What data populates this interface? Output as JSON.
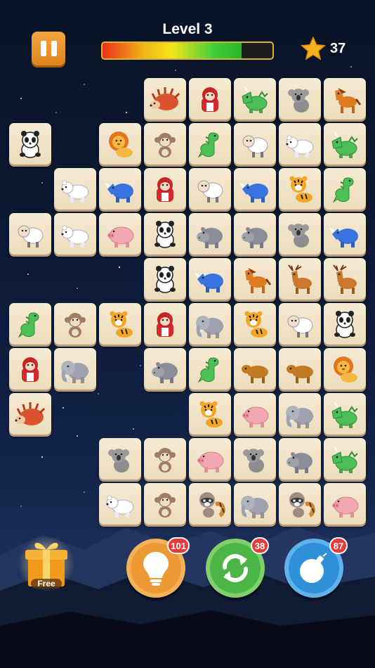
{
  "header": {
    "level_label": "Level 3",
    "progress_fraction": 0.82,
    "star_count": "37"
  },
  "colors": {
    "tile_face": "#f3e6cc",
    "pause_button": "#eb9530",
    "hint_button": "#f0a23a",
    "shuffle_button": "#4bb548",
    "bomb_button": "#2f8fd8",
    "badge": "#e83a3a"
  },
  "board": {
    "tiles": [
      {
        "col": 3,
        "row": 0,
        "animal": "hedgehog"
      },
      {
        "col": 4,
        "row": 0,
        "animal": "gorilla"
      },
      {
        "col": 5,
        "row": 0,
        "animal": "triceratops"
      },
      {
        "col": 6,
        "row": 0,
        "animal": "koala"
      },
      {
        "col": 7,
        "row": 0,
        "animal": "horse"
      },
      {
        "col": 0,
        "row": 1,
        "animal": "panda"
      },
      {
        "col": 2,
        "row": 1,
        "animal": "lion"
      },
      {
        "col": 3,
        "row": 1,
        "animal": "monkey"
      },
      {
        "col": 4,
        "row": 1,
        "animal": "dinosaur"
      },
      {
        "col": 5,
        "row": 1,
        "animal": "sheep"
      },
      {
        "col": 6,
        "row": 1,
        "animal": "polar-bear"
      },
      {
        "col": 7,
        "row": 1,
        "animal": "triceratops"
      },
      {
        "col": 1,
        "row": 2,
        "animal": "polar-bear"
      },
      {
        "col": 2,
        "row": 2,
        "animal": "rhino"
      },
      {
        "col": 3,
        "row": 2,
        "animal": "gorilla"
      },
      {
        "col": 4,
        "row": 2,
        "animal": "sheep"
      },
      {
        "col": 5,
        "row": 2,
        "animal": "rhino"
      },
      {
        "col": 6,
        "row": 2,
        "animal": "tiger"
      },
      {
        "col": 7,
        "row": 2,
        "animal": "dinosaur"
      },
      {
        "col": 0,
        "row": 3,
        "animal": "sheep"
      },
      {
        "col": 1,
        "row": 3,
        "animal": "polar-bear"
      },
      {
        "col": 2,
        "row": 3,
        "animal": "pig"
      },
      {
        "col": 3,
        "row": 3,
        "animal": "panda"
      },
      {
        "col": 4,
        "row": 3,
        "animal": "hippo"
      },
      {
        "col": 5,
        "row": 3,
        "animal": "hippo"
      },
      {
        "col": 6,
        "row": 3,
        "animal": "koala"
      },
      {
        "col": 7,
        "row": 3,
        "animal": "rhino"
      },
      {
        "col": 3,
        "row": 4,
        "animal": "panda"
      },
      {
        "col": 4,
        "row": 4,
        "animal": "rhino"
      },
      {
        "col": 5,
        "row": 4,
        "animal": "horse"
      },
      {
        "col": 6,
        "row": 4,
        "animal": "deer"
      },
      {
        "col": 7,
        "row": 4,
        "animal": "deer"
      },
      {
        "col": 0,
        "row": 5,
        "animal": "dinosaur"
      },
      {
        "col": 1,
        "row": 5,
        "animal": "monkey"
      },
      {
        "col": 2,
        "row": 5,
        "animal": "tiger"
      },
      {
        "col": 3,
        "row": 5,
        "animal": "gorilla"
      },
      {
        "col": 4,
        "row": 5,
        "animal": "elephant"
      },
      {
        "col": 5,
        "row": 5,
        "animal": "tiger"
      },
      {
        "col": 6,
        "row": 5,
        "animal": "sheep"
      },
      {
        "col": 7,
        "row": 5,
        "animal": "panda"
      },
      {
        "col": 0,
        "row": 6,
        "animal": "gorilla"
      },
      {
        "col": 1,
        "row": 6,
        "animal": "elephant"
      },
      {
        "col": 3,
        "row": 6,
        "animal": "hippo"
      },
      {
        "col": 4,
        "row": 6,
        "animal": "dinosaur"
      },
      {
        "col": 5,
        "row": 6,
        "animal": "ox"
      },
      {
        "col": 6,
        "row": 6,
        "animal": "ox"
      },
      {
        "col": 7,
        "row": 6,
        "animal": "lion"
      },
      {
        "col": 0,
        "row": 7,
        "animal": "hedgehog"
      },
      {
        "col": 4,
        "row": 7,
        "animal": "tiger"
      },
      {
        "col": 5,
        "row": 7,
        "animal": "pig"
      },
      {
        "col": 6,
        "row": 7,
        "animal": "elephant"
      },
      {
        "col": 7,
        "row": 7,
        "animal": "triceratops"
      },
      {
        "col": 2,
        "row": 8,
        "animal": "koala"
      },
      {
        "col": 3,
        "row": 8,
        "animal": "monkey"
      },
      {
        "col": 4,
        "row": 8,
        "animal": "pig"
      },
      {
        "col": 5,
        "row": 8,
        "animal": "koala"
      },
      {
        "col": 6,
        "row": 8,
        "animal": "hippo"
      },
      {
        "col": 7,
        "row": 8,
        "animal": "triceratops"
      },
      {
        "col": 2,
        "row": 9,
        "animal": "polar-bear"
      },
      {
        "col": 3,
        "row": 9,
        "animal": "monkey"
      },
      {
        "col": 4,
        "row": 9,
        "animal": "raccoon"
      },
      {
        "col": 5,
        "row": 9,
        "animal": "elephant"
      },
      {
        "col": 6,
        "row": 9,
        "animal": "raccoon"
      },
      {
        "col": 7,
        "row": 9,
        "animal": "pig"
      }
    ]
  },
  "powerups": {
    "gift_label": "Free",
    "hint_count": "101",
    "shuffle_count": "38",
    "bomb_count": "87",
    "gift_icon": "gift-box-icon",
    "hint_icon": "lightbulb-icon",
    "shuffle_icon": "shuffle-arrows-icon",
    "bomb_icon": "bomb-icon"
  }
}
